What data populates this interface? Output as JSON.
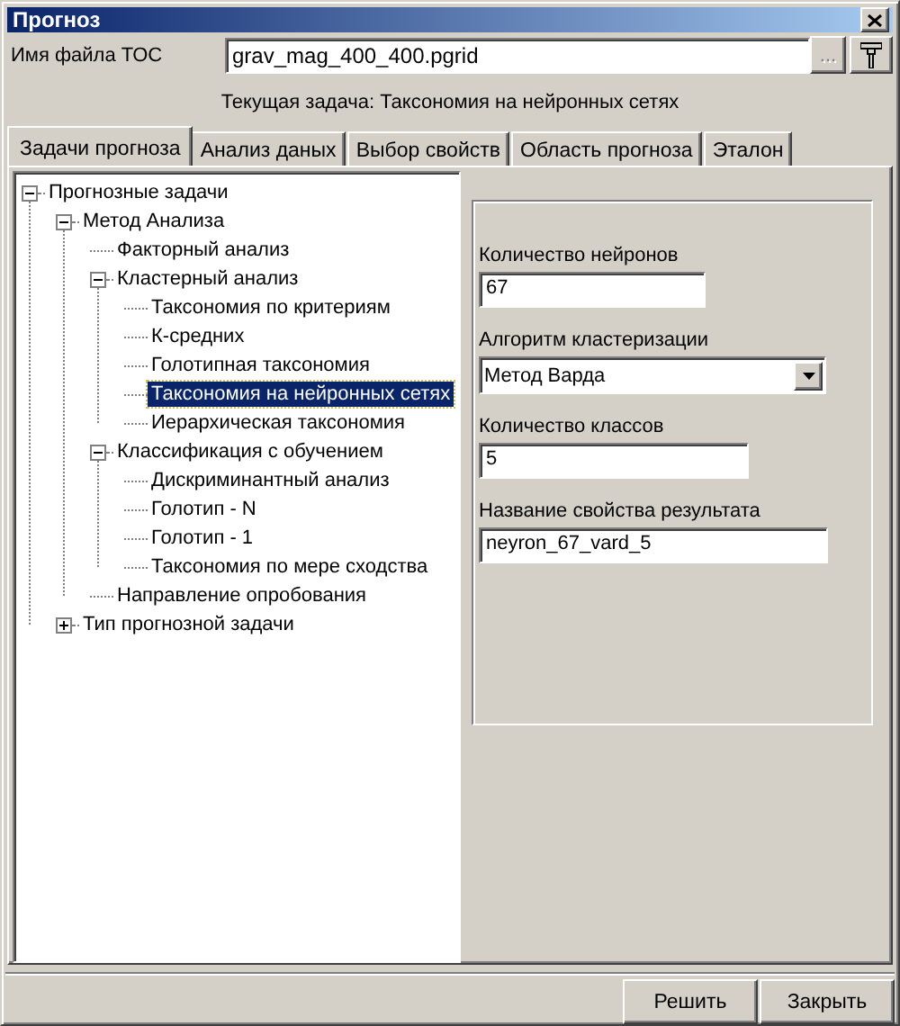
{
  "window": {
    "title": "Прогноз"
  },
  "file_row": {
    "label": "Имя файла ТОС",
    "value": "grav_mag_400_400.pgrid",
    "browse_button": {
      "label": "...",
      "disabled": true
    }
  },
  "current_task": "Текущая задача: Таксономия на нейронных сетях",
  "tabs": [
    {
      "label": "Задачи прогноза",
      "selected": true
    },
    {
      "label": "Анализ даных",
      "selected": false
    },
    {
      "label": "Выбор свойств",
      "selected": false
    },
    {
      "label": "Область прогноза",
      "selected": false
    },
    {
      "label": "Эталон",
      "selected": false
    }
  ],
  "tree": [
    {
      "label": "Прогнозные задачи",
      "selected": false,
      "expanded": true,
      "children": [
        {
          "label": "Метод Анализа",
          "selected": false,
          "expanded": true,
          "children": [
            {
              "label": "Факторный анализ",
              "selected": false
            },
            {
              "label": "Кластерный анализ",
              "selected": false,
              "expanded": true,
              "children": [
                {
                  "label": "Таксономия по критериям",
                  "selected": false
                },
                {
                  "label": "К-средних",
                  "selected": false
                },
                {
                  "label": "Голотипная таксономия",
                  "selected": false
                },
                {
                  "label": "Таксономия на нейронных сетях",
                  "selected": true
                },
                {
                  "label": "Иерархическая таксономия",
                  "selected": false
                }
              ]
            },
            {
              "label": "Классификация с обучением",
              "selected": false,
              "expanded": true,
              "children": [
                {
                  "label": "Дискриминантный анализ",
                  "selected": false
                },
                {
                  "label": "Голотип - N",
                  "selected": false
                },
                {
                  "label": "Голотип - 1",
                  "selected": false
                },
                {
                  "label": "Таксономия по мере сходства",
                  "selected": false
                }
              ]
            },
            {
              "label": "Направление опробования",
              "selected": false
            }
          ]
        },
        {
          "label": "Тип прогнозной задачи",
          "selected": false,
          "expanded": false
        }
      ]
    }
  ],
  "settings": [
    {
      "kind": "text",
      "label": "Количество нейронов",
      "value": "67"
    },
    {
      "kind": "select",
      "label": "Алгоритм кластеризации",
      "value": "Метод Варда"
    },
    {
      "kind": "text",
      "label": "Количество классов",
      "value": "5"
    },
    {
      "kind": "text",
      "label": "Название свойства результата",
      "value": "neyron_67_vard_5"
    }
  ],
  "buttons": [
    {
      "label": "Решить"
    },
    {
      "label": "Закрыть"
    }
  ]
}
